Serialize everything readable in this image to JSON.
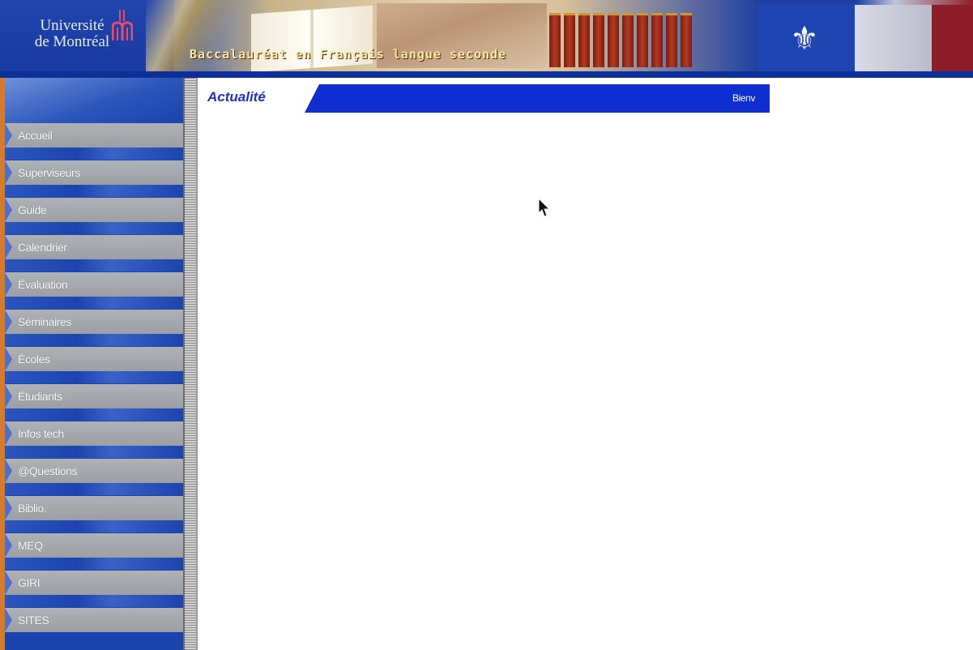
{
  "header": {
    "logo_line1": "Université",
    "logo_line2": "de Montréal",
    "tagline": "Baccalauréat en Français langue seconde"
  },
  "sidebar": {
    "items": [
      {
        "label": "Accueil"
      },
      {
        "label": "Superviseurs"
      },
      {
        "label": "Guide"
      },
      {
        "label": "Calendrier"
      },
      {
        "label": "Évaluation"
      },
      {
        "label": "Séminaires"
      },
      {
        "label": "Écoles"
      },
      {
        "label": "Étudiants"
      },
      {
        "label": "Infos tech"
      },
      {
        "label": "@Questions"
      },
      {
        "label": "Biblio."
      },
      {
        "label": "MEQ"
      },
      {
        "label": "GIRI"
      },
      {
        "label": "SITES"
      }
    ]
  },
  "main": {
    "title": "Actualité",
    "welcome_text": "Bienv"
  },
  "colors": {
    "banner_blue": "#1839a0",
    "title_bar_blue": "#0f2ed1",
    "nav_button_gray": "#a4a8ac",
    "sidebar_accent_orange": "#d77a2a"
  }
}
